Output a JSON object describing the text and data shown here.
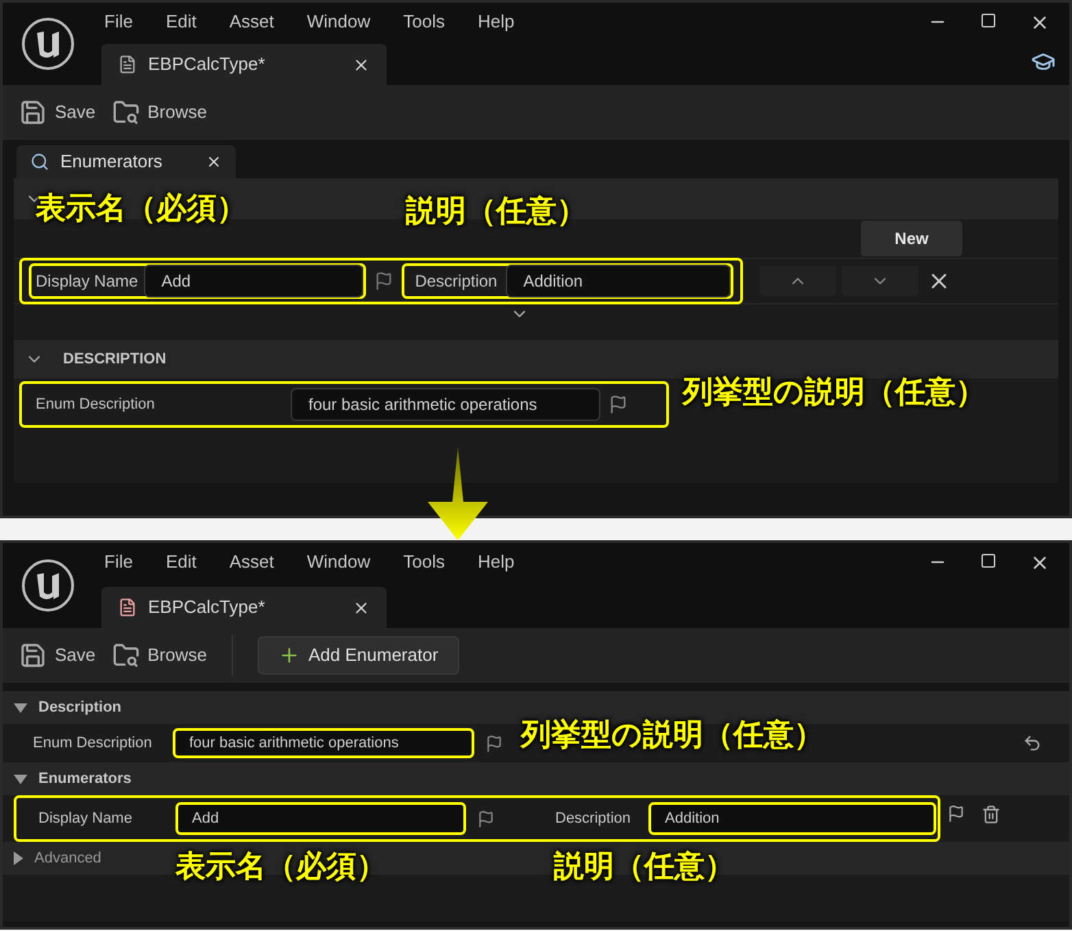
{
  "top": {
    "menu": [
      "File",
      "Edit",
      "Asset",
      "Window",
      "Tools",
      "Help"
    ],
    "doc_tab": "EBPCalcType*",
    "toolbar": [
      "Save",
      "Browse"
    ],
    "panel_tab": "Enumerators",
    "new_button": "New",
    "display_name_label": "Display Name",
    "display_name": "Add",
    "description_label": "Description",
    "description": "Addition",
    "description_section": "DESCRIPTION",
    "enum_description_label": "Enum Description",
    "enum_description": "four basic arithmetic operations",
    "annotations": [
      "表示名（必須）",
      "説明（任意）",
      "列挙型の説明（任意）"
    ]
  },
  "bottom": {
    "menu": [
      "File",
      "Edit",
      "Asset",
      "Window",
      "Tools",
      "Help"
    ],
    "doc_tab": "EBPCalcType*",
    "toolbar": [
      "Save",
      "Browse"
    ],
    "add_button": "Add Enumerator",
    "sections": [
      {
        "title": "Description",
        "expanded": true
      },
      {
        "title": "Enumerators",
        "expanded": true
      },
      {
        "title": "Advanced",
        "expanded": false
      }
    ],
    "enum_description_label": "Enum Description",
    "enum_description": "four basic arithmetic operations",
    "display_name_label": "Display Name",
    "display_name": "Add",
    "description_label": "Description",
    "description": "Addition",
    "annotations": [
      "列挙型の説明（任意）",
      "表示名（必須）",
      "説明（任意）"
    ]
  }
}
